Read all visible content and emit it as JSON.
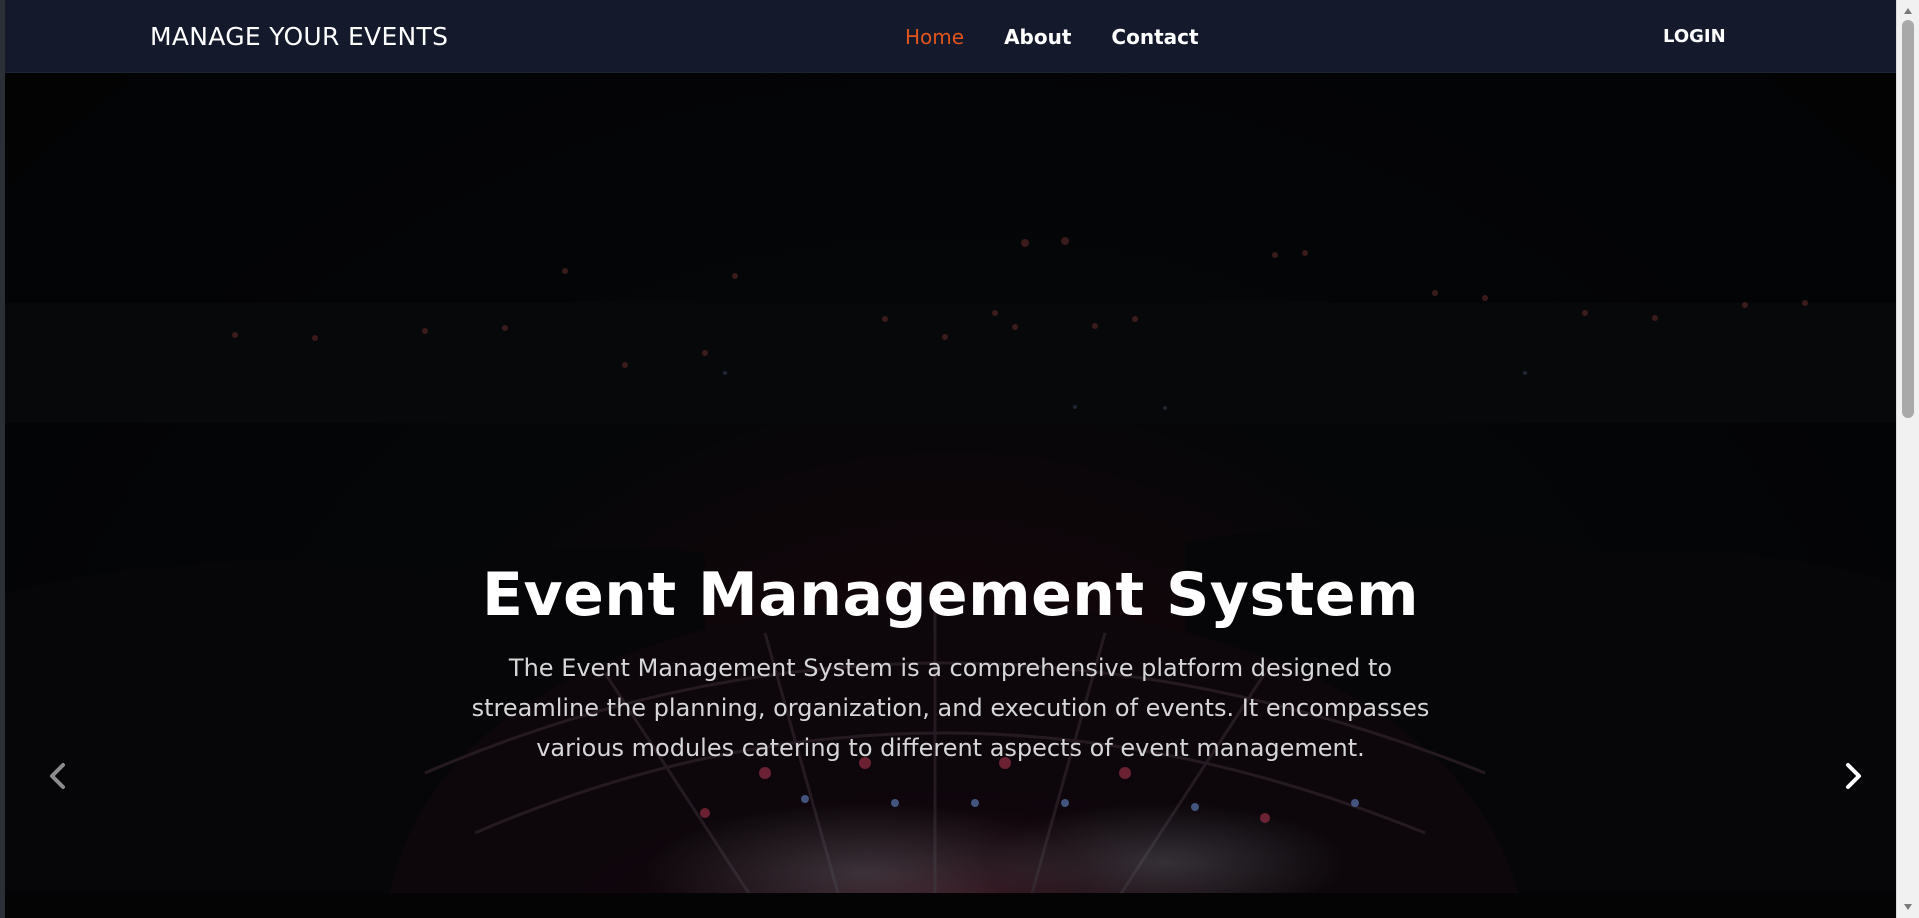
{
  "navbar": {
    "brand": "MANAGE YOUR EVENTS",
    "links": [
      {
        "label": "Home",
        "active": true
      },
      {
        "label": "About",
        "active": false
      },
      {
        "label": "Contact",
        "active": false
      }
    ],
    "login_label": "LOGIN"
  },
  "hero": {
    "title": "Event Management System",
    "description": "The Event Management System is a comprehensive platform designed to streamline the planning, organization, and execution of events. It encompasses various modules catering to different aspects of event management.",
    "prev_icon": "chevron-left-icon",
    "next_icon": "chevron-right-icon"
  },
  "colors": {
    "navbar_bg": "#141a2b",
    "active_link": "#e0541d",
    "text": "#ffffff"
  }
}
